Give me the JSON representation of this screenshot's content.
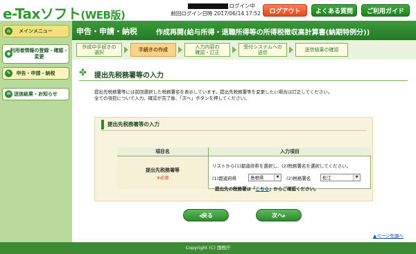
{
  "header": {
    "logo_main": "e-Tax",
    "logo_sub": "ソフト",
    "logo_web": "(WEB版)",
    "login_user_suffix": "ログイン中",
    "login_date_label": "前回ログイン日時",
    "login_date_value": "2017/06/14 17:52",
    "logout_label": "ログアウト",
    "faq_label": "よくある質問",
    "guide_label": "ご利用ガイド"
  },
  "sidebar": {
    "items": [
      {
        "label": "メインメニュー"
      },
      {
        "label": "利用者情報の登録・確認・変更"
      },
      {
        "label": "申告・申請・納税"
      },
      {
        "label": "送信結果・お知らせ"
      }
    ]
  },
  "main": {
    "title": "申告・申請・納税",
    "subtitle": "作成再開(給与所得・退職所得等の所得税徴収高計算書(納期特例分))"
  },
  "steps": [
    {
      "label": "作成中手続きの\n選択"
    },
    {
      "label": "手続きの作成"
    },
    {
      "label": "入力内容の\n確認・訂正"
    },
    {
      "label": "受付システムへの\n送信"
    },
    {
      "label": "送信結果の確認"
    }
  ],
  "section": {
    "title": "提出先税務署等の入力",
    "desc_line1": "提出先税務署等には前回選択した税務署名を表示しています。提出先税務署等を変更したい場合は訂正してください。",
    "desc_line2": "全ての項目について入力、確認が完了後、「次へ」ボタンを押してください。"
  },
  "form": {
    "heading": "提出先税務署等の入力",
    "col_item": "項目名",
    "col_input": "入力項目",
    "row_label": "提出先税務署等",
    "required": "※必須",
    "hint": "リストから(1)都道府県を選択し、(2)税務署名を選択してください。",
    "pref_label": "(1)都道府県",
    "pref_value": "島根県",
    "office_label": "(2)税務署名",
    "office_value": "松江",
    "confirm_prefix": "提出先の税務署は「",
    "confirm_link": "こちら",
    "confirm_suffix": "」からご確認ください。"
  },
  "buttons": {
    "back": "戻る",
    "next": "次へ"
  },
  "page_top": "ページ先頭へ",
  "footer": "Copyright (C) 国税庁"
}
